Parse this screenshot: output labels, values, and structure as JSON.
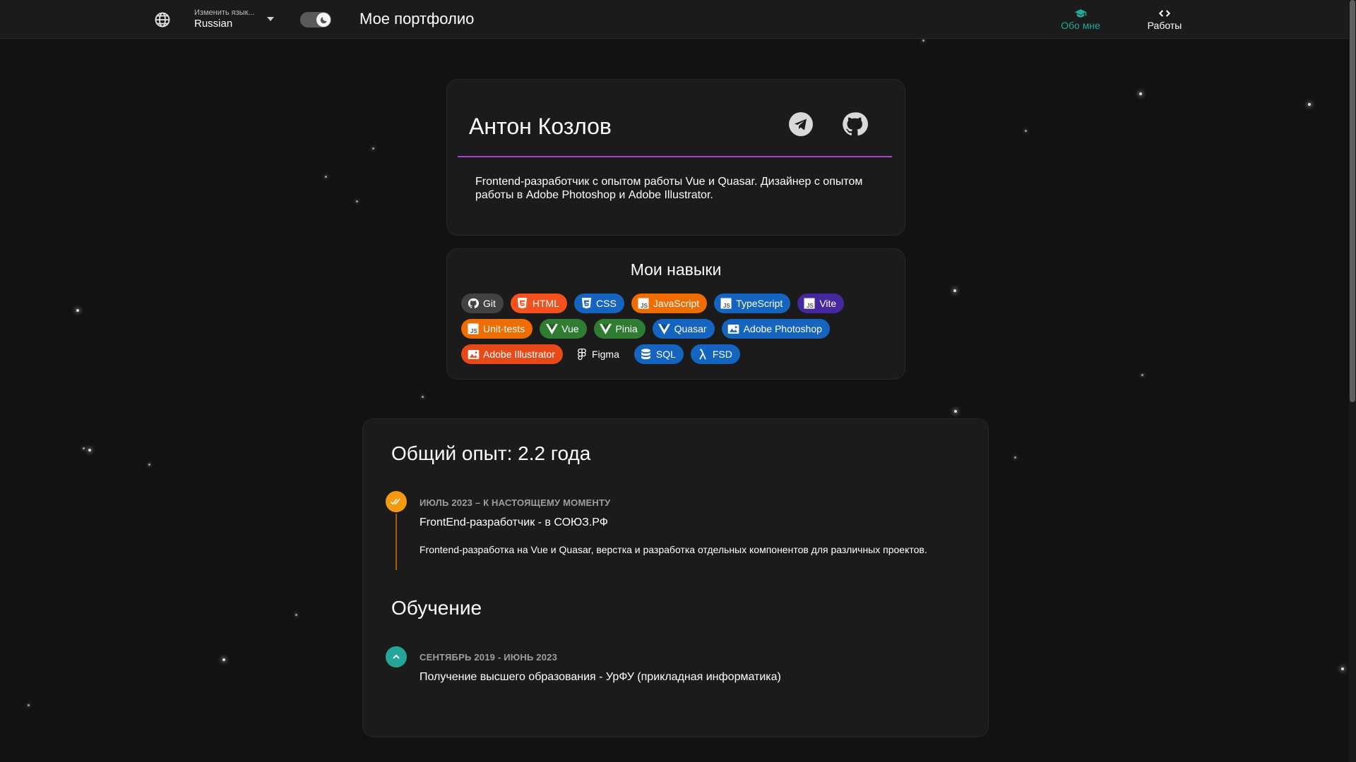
{
  "header": {
    "language_label": "Изменить язык...",
    "language_value": "Russian",
    "site_title": "Мое портфолио",
    "nav": [
      {
        "label": "Обо мне",
        "icon": "graduation-cap-icon",
        "active": true
      },
      {
        "label": "Работы",
        "icon": "code-icon",
        "active": false
      }
    ]
  },
  "profile": {
    "name": "Антон Козлов",
    "bio": "Frontend-разработчик с опытом работы Vue и Quasar. Дизайнер с опытом работы в Adobe Photoshop и Adobe Illustrator.",
    "social": [
      "telegram-icon",
      "github-icon"
    ]
  },
  "skills": {
    "title": "Мои навыки",
    "items": [
      {
        "label": "Git",
        "color": "#424242",
        "icon": "github-icon"
      },
      {
        "label": "HTML",
        "color": "#f4511e",
        "icon": "html5-icon"
      },
      {
        "label": "CSS",
        "color": "#1565c0",
        "icon": "css3-icon"
      },
      {
        "label": "JavaScript",
        "color": "#ef6c00",
        "icon": "js-icon"
      },
      {
        "label": "TypeScript",
        "color": "#1565c0",
        "icon": "js-icon"
      },
      {
        "label": "Vite",
        "color": "#4527a0",
        "icon": "js-icon"
      },
      {
        "label": "Unit-tests",
        "color": "#ef6c00",
        "icon": "js-icon"
      },
      {
        "label": "Vue",
        "color": "#2e7d32",
        "icon": "vue-icon"
      },
      {
        "label": "Pinia",
        "color": "#2e7d32",
        "icon": "vue-icon"
      },
      {
        "label": "Quasar",
        "color": "#1565c0",
        "icon": "vue-icon"
      },
      {
        "label": "Adobe Photoshop",
        "color": "#1565c0",
        "icon": "image-icon"
      },
      {
        "label": "Adobe Illustrator",
        "color": "#e64a19",
        "icon": "image-icon"
      },
      {
        "label": "Figma",
        "color": "#1b1b1b",
        "icon": "figma-icon"
      },
      {
        "label": "SQL",
        "color": "#1565c0",
        "icon": "database-icon"
      },
      {
        "label": "FSD",
        "color": "#1565c0",
        "icon": "lambda-icon"
      }
    ]
  },
  "experience": {
    "title": "Общий опыт: 2.2 года",
    "job": {
      "dates": "ИЮЛЬ 2023 – К НАСТОЯЩЕМУ МОМЕНТУ",
      "heading": "FrontEnd-разработчик - в СОЮЗ.РФ",
      "description": "Frontend-разработка на Vue и Quasar, верстка и разработка отдельных компонентов для различных проектов."
    },
    "education_title": "Обучение",
    "education": {
      "dates": "СЕНТЯБРЬ 2019 - ИЮНЬ 2023",
      "heading": "Получение высшего образования - УрФУ (прикладная информатика)"
    }
  }
}
